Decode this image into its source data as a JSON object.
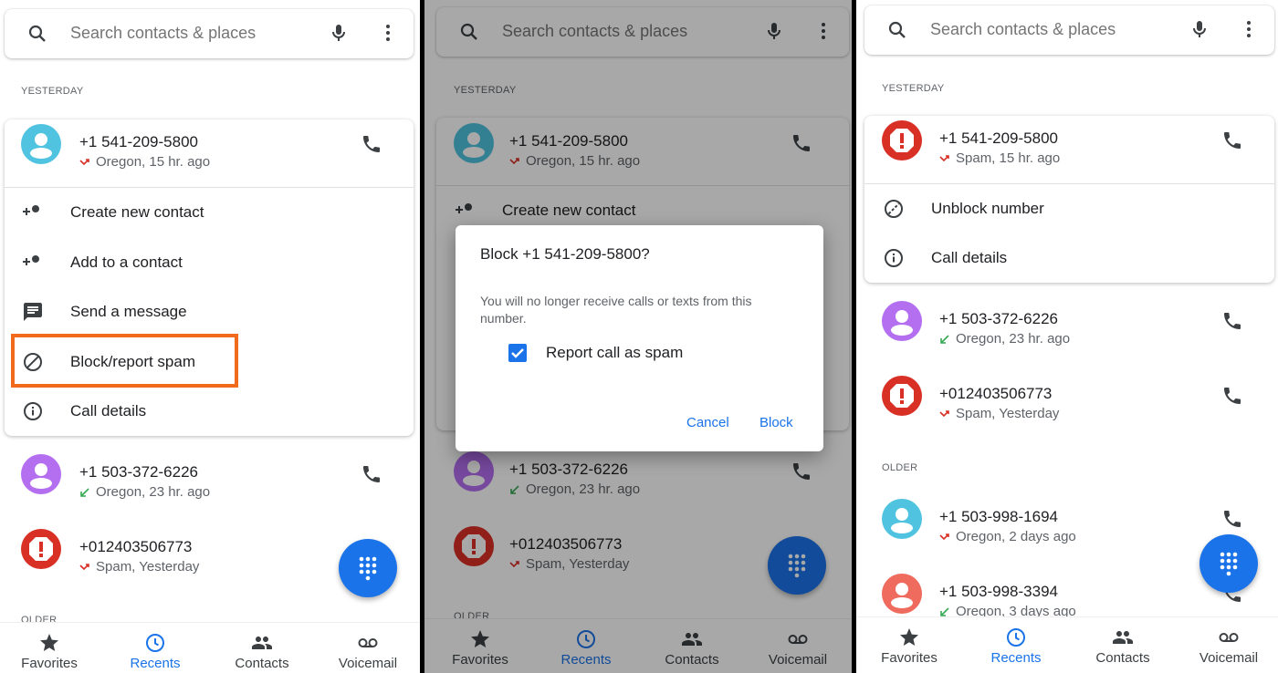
{
  "colors": {
    "accent": "#1a73e8",
    "highlight": "#f26a1b",
    "spam_red": "#d93025",
    "missed_red": "#d93025",
    "received_green": "#34a853",
    "avatar_cyan": "#4fc3e0",
    "avatar_purple": "#b46ef0",
    "avatar_salmon": "#ee6b5e"
  },
  "panels": [
    {
      "search": {
        "placeholder": "Search contacts & places",
        "icons": [
          "search-icon",
          "mic-icon",
          "more-vert-icon"
        ]
      },
      "sections": {
        "yesterday": "YESTERDAY",
        "older": "OLDER"
      },
      "expanded": {
        "number": "+1 541-209-5800",
        "detail": "Oregon, 15 hr. ago",
        "avatar": "person",
        "color": "#4fc3e0",
        "call_type": "missed"
      },
      "menu": [
        {
          "label": "Create new contact",
          "icon": "person-add-icon"
        },
        {
          "label": "Add to a contact",
          "icon": "person-add-icon"
        },
        {
          "label": "Send a message",
          "icon": "message-icon"
        },
        {
          "label": "Block/report spam",
          "icon": "block-icon",
          "highlighted": true
        },
        {
          "label": "Call details",
          "icon": "info-icon"
        }
      ],
      "rows": [
        {
          "number": "+1 503-372-6226",
          "detail": "Oregon, 23 hr. ago",
          "avatar": "person",
          "color": "#b46ef0",
          "call_type": "received"
        },
        {
          "number": "+012403506773",
          "detail": "Spam, Yesterday",
          "avatar": "spam",
          "color": "#d93025",
          "call_type": "missed"
        }
      ],
      "nav": [
        {
          "label": "Favorites",
          "icon": "star-icon"
        },
        {
          "label": "Recents",
          "icon": "clock-icon",
          "active": true
        },
        {
          "label": "Contacts",
          "icon": "people-icon"
        },
        {
          "label": "Voicemail",
          "icon": "voicemail-icon"
        }
      ]
    },
    {
      "search": {
        "placeholder": "Search contacts & places",
        "icons": [
          "search-icon",
          "mic-icon",
          "more-vert-icon"
        ]
      },
      "sections": {
        "yesterday": "YESTERDAY",
        "older": "OLDER"
      },
      "expanded": {
        "number": "+1 541-209-5800",
        "detail": "Oregon, 15 hr. ago",
        "avatar": "person",
        "color": "#4fc3e0",
        "call_type": "missed"
      },
      "menu": [
        {
          "label": "Create new contact",
          "icon": "person-add-icon"
        }
      ],
      "rows": [
        {
          "number": "+1 503-372-6226",
          "detail": "Oregon, 23 hr. ago",
          "avatar": "person",
          "color": "#b46ef0",
          "call_type": "received"
        },
        {
          "number": "+012403506773",
          "detail": "Spam, Yesterday",
          "avatar": "spam",
          "color": "#d93025",
          "call_type": "missed"
        }
      ],
      "nav": [
        {
          "label": "Favorites",
          "icon": "star-icon"
        },
        {
          "label": "Recents",
          "icon": "clock-icon",
          "active": true
        },
        {
          "label": "Contacts",
          "icon": "people-icon"
        },
        {
          "label": "Voicemail",
          "icon": "voicemail-icon"
        }
      ],
      "dialog": {
        "title": "Block +1 541-209-5800?",
        "body": "You will no longer receive calls or texts from this number.",
        "checkbox_label": "Report call as spam",
        "checkbox_checked": true,
        "cancel": "Cancel",
        "confirm": "Block"
      }
    },
    {
      "search": {
        "placeholder": "Search contacts & places",
        "icons": [
          "search-icon",
          "mic-icon",
          "more-vert-icon"
        ]
      },
      "sections": {
        "yesterday": "YESTERDAY",
        "older": "OLDER"
      },
      "expanded": {
        "number": "+1 541-209-5800",
        "detail": "Spam, 15 hr. ago",
        "avatar": "spam",
        "color": "#d93025",
        "call_type": "missed"
      },
      "menu": [
        {
          "label": "Unblock number",
          "icon": "unblock-icon"
        },
        {
          "label": "Call details",
          "icon": "info-icon"
        }
      ],
      "rows": [
        {
          "number": "+1 503-372-6226",
          "detail": "Oregon, 23 hr. ago",
          "avatar": "person",
          "color": "#b46ef0",
          "call_type": "received"
        },
        {
          "number": "+012403506773",
          "detail": "Spam, Yesterday",
          "avatar": "spam",
          "color": "#d93025",
          "call_type": "missed"
        }
      ],
      "older_rows": [
        {
          "number": "+1 503-998-1694",
          "detail": "Oregon, 2 days ago",
          "avatar": "person",
          "color": "#4fc3e0",
          "call_type": "missed"
        },
        {
          "number": "+1 503-998-3394",
          "detail": "Oregon, 3 days ago",
          "avatar": "person",
          "color": "#ee6b5e",
          "call_type": "received"
        }
      ],
      "nav": [
        {
          "label": "Favorites",
          "icon": "star-icon"
        },
        {
          "label": "Recents",
          "icon": "clock-icon",
          "active": true
        },
        {
          "label": "Contacts",
          "icon": "people-icon"
        },
        {
          "label": "Voicemail",
          "icon": "voicemail-icon"
        }
      ]
    }
  ]
}
